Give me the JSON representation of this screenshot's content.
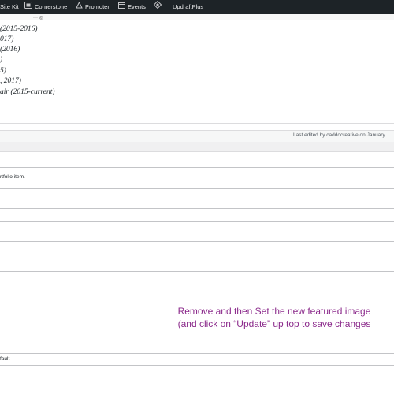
{
  "adminbar": {
    "items": [
      {
        "label": "Site Kit",
        "icon": "google-g-icon"
      },
      {
        "label": "Cornerstone",
        "icon": "cornerstone-icon"
      },
      {
        "label": "Promoter",
        "icon": "promoter-icon"
      },
      {
        "label": "Events",
        "icon": "calendar-icon"
      },
      {
        "label": "",
        "icon": "diamond-icon"
      },
      {
        "label": "UpdraftPlus",
        "icon": ""
      }
    ]
  },
  "bio": {
    "lines": [
      "(2015-2016)",
      "017)",
      "(2016)",
      ")",
      "5)",
      ", 2017)",
      "air (2015-current)"
    ]
  },
  "status": {
    "last_edited": "Last edited by caddocreative on January"
  },
  "meta": {
    "portfolio_text": "rtfolio item.",
    "default_text": "fault"
  },
  "annotation": {
    "line1": "Remove and then Set the new featured image",
    "line2": "(and click on “Update” up top to save changes"
  },
  "colors": {
    "adminbar_bg": "#1d2327",
    "annotation": "#8b2a8b"
  }
}
